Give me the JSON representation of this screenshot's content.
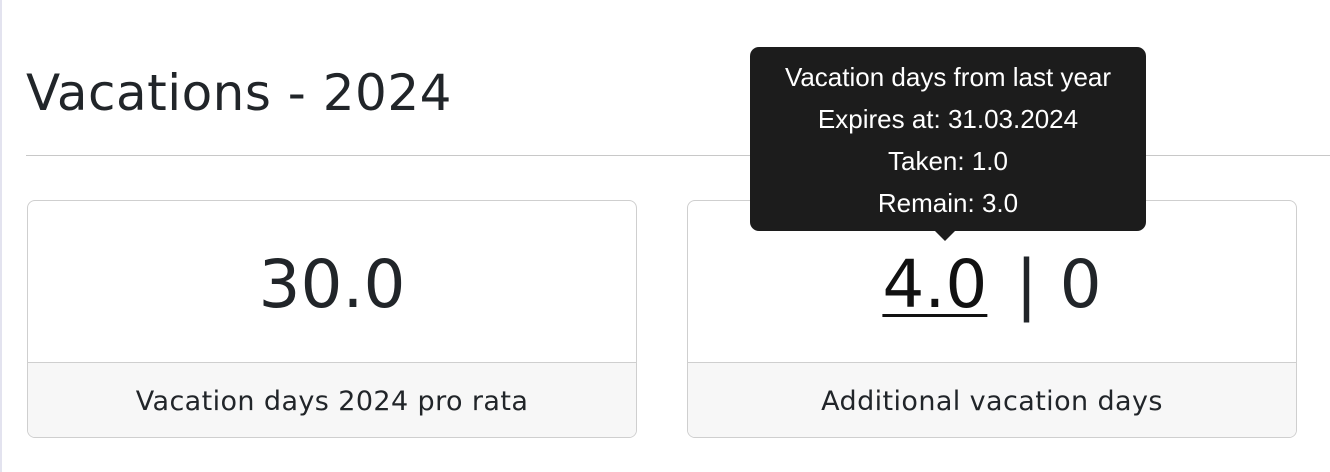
{
  "page": {
    "title": "Vacations - 2024"
  },
  "cards": [
    {
      "value": "30.0",
      "label": "Vacation days 2024 pro rata"
    },
    {
      "carryover_value": "4.0",
      "separator": "|",
      "additional_value": "0",
      "label": "Additional vacation days"
    }
  ],
  "tooltip": {
    "lines": [
      "Vacation days from last year",
      "Expires at: 31.03.2024",
      "Taken: 1.0",
      "Remain: 3.0"
    ]
  },
  "colors": {
    "tooltip_background": "#1c1c1c",
    "card_footer_background": "#f7f7f7",
    "border": "#cfcfcf",
    "text": "#212529"
  }
}
